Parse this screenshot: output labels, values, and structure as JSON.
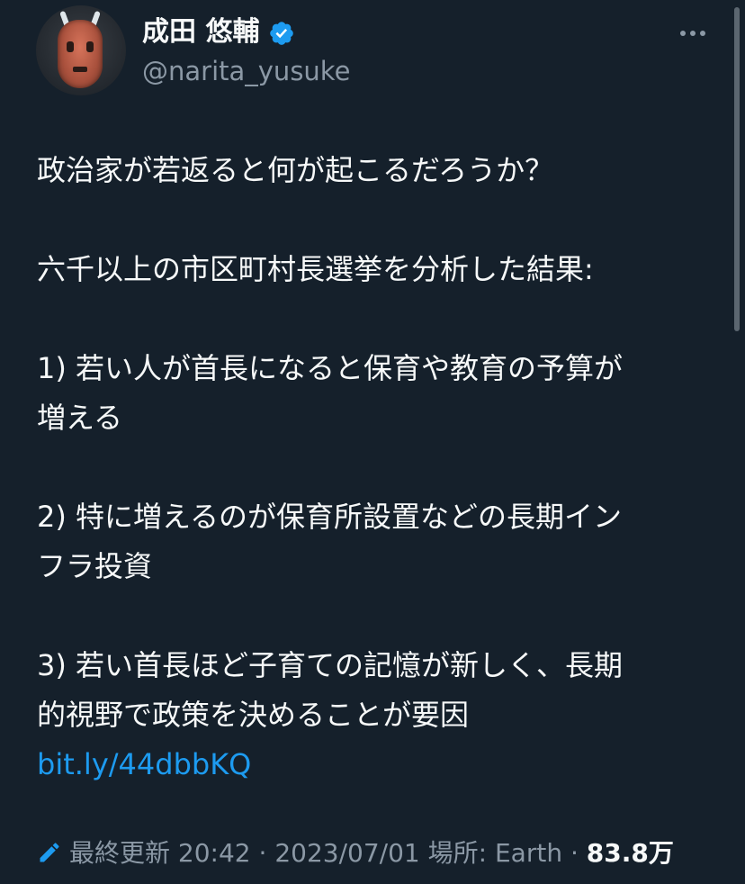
{
  "author": {
    "display_name": "成田 悠輔",
    "handle": "@narita_yusuke",
    "verified": true,
    "avatar_icon": "tribal-mask-avatar"
  },
  "tweet": {
    "line1": "政治家が若返ると何が起こるだろうか？",
    "line2": "六千以上の市区町村長選挙を分析した結果:",
    "line3a": "1) 若い人が首長になると保育や教育の予算が",
    "line3b": "増える",
    "line4a": "2) 特に増えるのが保育所設置などの長期イン",
    "line4b": "フラ投資",
    "line5a": "3) 若い首長ほど子育ての記憶が新しく、長期",
    "line5b": "的視野で政策を決めることが要因",
    "link": "bit.ly/44dbbKQ"
  },
  "meta": {
    "edited_label": "最終更新",
    "time": "20:42",
    "sep1": "·",
    "date": "2023/07/01",
    "location_label": "場所: Earth",
    "sep2": "·",
    "views": "83.8万"
  },
  "colors": {
    "background": "#15202b",
    "text": "#f7f9f9",
    "muted": "#8b98a5",
    "link": "#1d9bf0",
    "verified": "#1d9bf0"
  },
  "icons": {
    "verified": "verified-badge-icon",
    "more": "more-options-icon",
    "edit": "pencil-icon"
  }
}
